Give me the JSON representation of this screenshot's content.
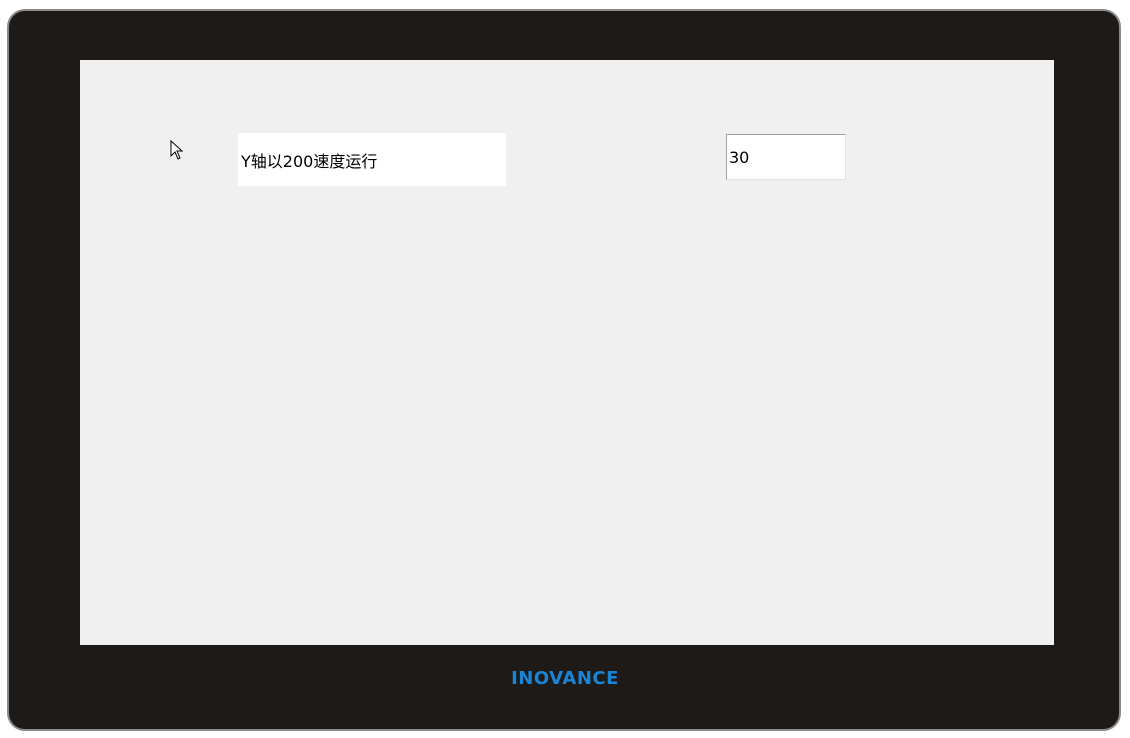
{
  "screen": {
    "status_text": "Y轴以200速度运行",
    "numeric_value": "30"
  },
  "bezel": {
    "brand": "INOVANCE"
  },
  "colors": {
    "bezel": "#1e1a18",
    "screen_background": "#f0f0f0",
    "brand": "#1a84d6"
  },
  "icons": {
    "cursor": "mouse-pointer-icon"
  }
}
